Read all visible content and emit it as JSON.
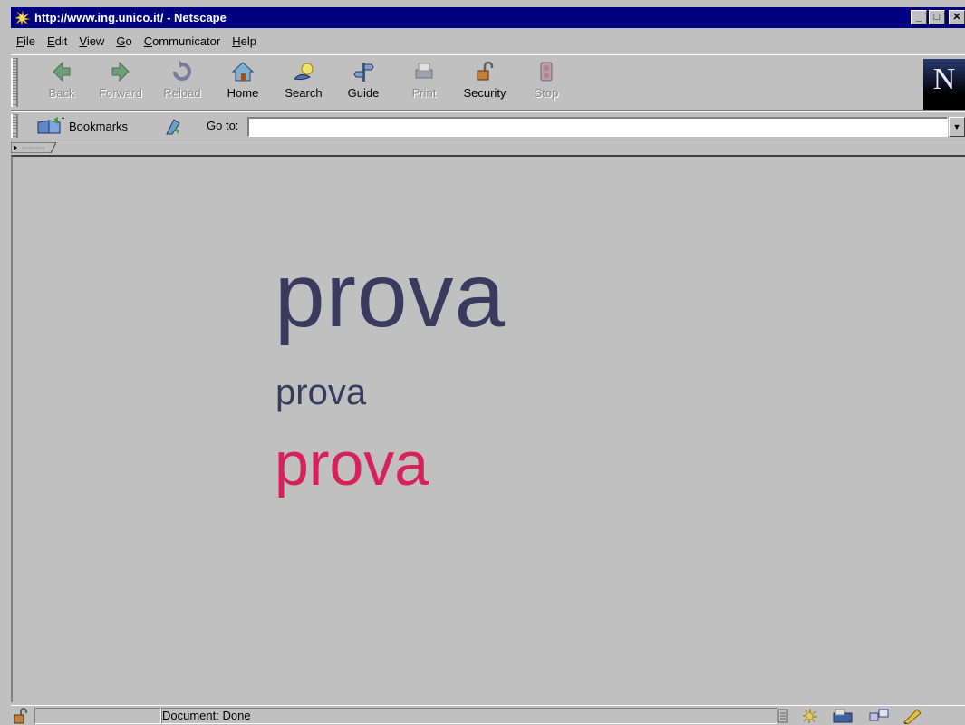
{
  "window": {
    "title": "http://www.ing.unico.it/ - Netscape"
  },
  "menu": {
    "items": [
      {
        "key": "F",
        "rest": "ile"
      },
      {
        "key": "E",
        "rest": "dit"
      },
      {
        "key": "V",
        "rest": "iew"
      },
      {
        "key": "G",
        "rest": "o"
      },
      {
        "key": "C",
        "rest": "ommunicator"
      },
      {
        "key": "H",
        "rest": "elp"
      }
    ]
  },
  "toolbar": {
    "back": "Back",
    "forward": "Forward",
    "reload": "Reload",
    "home": "Home",
    "search": "Search",
    "guide": "Guide",
    "print": "Print",
    "security": "Security",
    "stop": "Stop",
    "logo": "N"
  },
  "location": {
    "bookmarks_label": "Bookmarks",
    "goto_label": "Go to:",
    "url_value": ""
  },
  "content": {
    "line1": "prova",
    "line2": "prova",
    "line3": "prova",
    "colors": {
      "dark": "#3b3a5e",
      "accent": "#d6225a"
    }
  },
  "status": {
    "text": "Document: Done"
  }
}
